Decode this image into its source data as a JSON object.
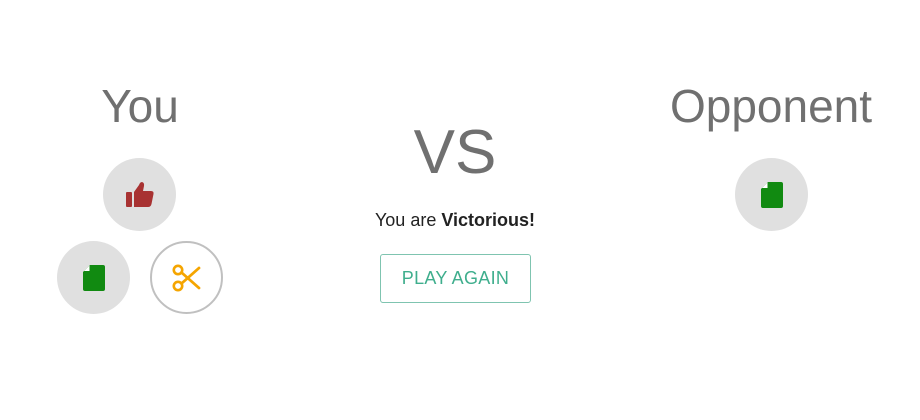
{
  "players": {
    "you": {
      "title": "You"
    },
    "opponent": {
      "title": "Opponent"
    }
  },
  "versus_label": "VS",
  "result": {
    "prefix": "You are",
    "outcome": "Victorious!"
  },
  "play_again_label": "PLAY AGAIN",
  "choices": {
    "you": [
      {
        "name": "rock",
        "icon": "thumbs-up-icon",
        "color": "#a83232",
        "selected": false
      },
      {
        "name": "paper",
        "icon": "paper-icon",
        "color": "#118a11",
        "selected": false
      },
      {
        "name": "scissors",
        "icon": "scissors-icon",
        "color": "#f5a500",
        "selected": true
      }
    ],
    "opponent": [
      {
        "name": "paper",
        "icon": "paper-icon",
        "color": "#118a11",
        "selected": false
      }
    ]
  }
}
